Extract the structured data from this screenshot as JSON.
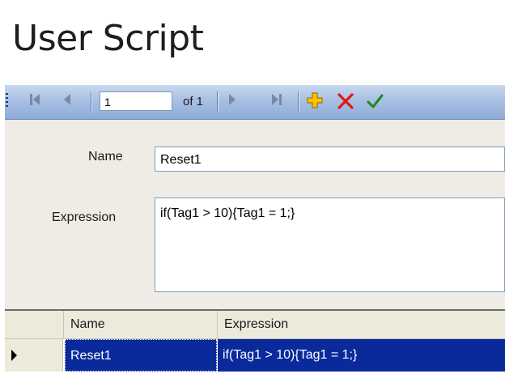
{
  "page": {
    "title": "User Script"
  },
  "navigator": {
    "position_value": "1",
    "of_text": "of 1",
    "icons": {
      "first": "first-record-icon",
      "previous": "previous-record-icon",
      "next": "next-record-icon",
      "last": "last-record-icon",
      "add": "add-icon",
      "delete": "delete-icon",
      "save": "save-checkmark-icon"
    },
    "colors": {
      "add": "#f0a800",
      "delete": "#e01818",
      "save": "#1a8a1a"
    }
  },
  "form": {
    "name_label": "Name",
    "name_value": "Reset1",
    "expression_label": "Expression",
    "expression_value": "if(Tag1 > 10){Tag1 = 1;}"
  },
  "grid": {
    "columns": [
      "Name",
      "Expression"
    ],
    "rows": [
      {
        "name": "Reset1",
        "expression": "if(Tag1 > 10){Tag1 = 1;}",
        "selected": true
      }
    ],
    "selection_color": "#0a2a9c"
  }
}
